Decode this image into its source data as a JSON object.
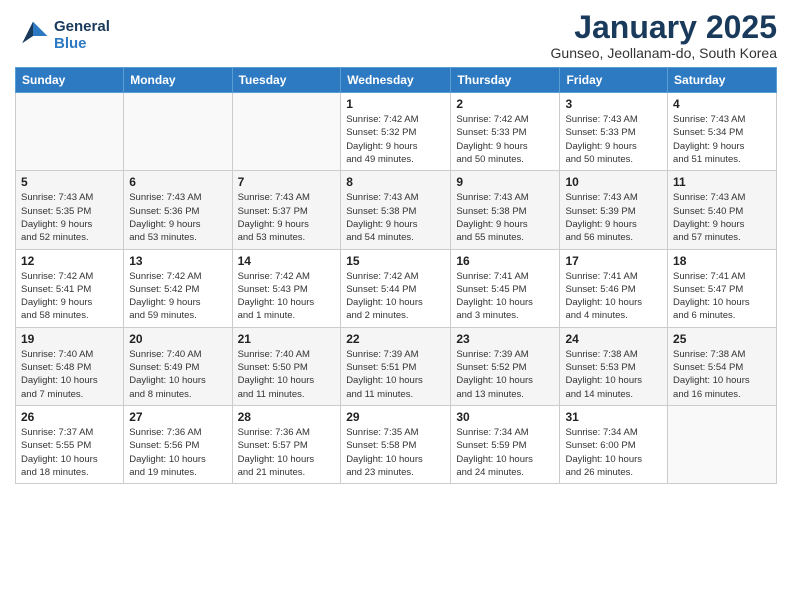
{
  "header": {
    "logo_line1": "General",
    "logo_line2": "Blue",
    "title": "January 2025",
    "subtitle": "Gunseo, Jeollanam-do, South Korea"
  },
  "weekdays": [
    "Sunday",
    "Monday",
    "Tuesday",
    "Wednesday",
    "Thursday",
    "Friday",
    "Saturday"
  ],
  "weeks": [
    [
      {
        "day": "",
        "info": ""
      },
      {
        "day": "",
        "info": ""
      },
      {
        "day": "",
        "info": ""
      },
      {
        "day": "1",
        "info": "Sunrise: 7:42 AM\nSunset: 5:32 PM\nDaylight: 9 hours\nand 49 minutes."
      },
      {
        "day": "2",
        "info": "Sunrise: 7:42 AM\nSunset: 5:33 PM\nDaylight: 9 hours\nand 50 minutes."
      },
      {
        "day": "3",
        "info": "Sunrise: 7:43 AM\nSunset: 5:33 PM\nDaylight: 9 hours\nand 50 minutes."
      },
      {
        "day": "4",
        "info": "Sunrise: 7:43 AM\nSunset: 5:34 PM\nDaylight: 9 hours\nand 51 minutes."
      }
    ],
    [
      {
        "day": "5",
        "info": "Sunrise: 7:43 AM\nSunset: 5:35 PM\nDaylight: 9 hours\nand 52 minutes."
      },
      {
        "day": "6",
        "info": "Sunrise: 7:43 AM\nSunset: 5:36 PM\nDaylight: 9 hours\nand 53 minutes."
      },
      {
        "day": "7",
        "info": "Sunrise: 7:43 AM\nSunset: 5:37 PM\nDaylight: 9 hours\nand 53 minutes."
      },
      {
        "day": "8",
        "info": "Sunrise: 7:43 AM\nSunset: 5:38 PM\nDaylight: 9 hours\nand 54 minutes."
      },
      {
        "day": "9",
        "info": "Sunrise: 7:43 AM\nSunset: 5:38 PM\nDaylight: 9 hours\nand 55 minutes."
      },
      {
        "day": "10",
        "info": "Sunrise: 7:43 AM\nSunset: 5:39 PM\nDaylight: 9 hours\nand 56 minutes."
      },
      {
        "day": "11",
        "info": "Sunrise: 7:43 AM\nSunset: 5:40 PM\nDaylight: 9 hours\nand 57 minutes."
      }
    ],
    [
      {
        "day": "12",
        "info": "Sunrise: 7:42 AM\nSunset: 5:41 PM\nDaylight: 9 hours\nand 58 minutes."
      },
      {
        "day": "13",
        "info": "Sunrise: 7:42 AM\nSunset: 5:42 PM\nDaylight: 9 hours\nand 59 minutes."
      },
      {
        "day": "14",
        "info": "Sunrise: 7:42 AM\nSunset: 5:43 PM\nDaylight: 10 hours\nand 1 minute."
      },
      {
        "day": "15",
        "info": "Sunrise: 7:42 AM\nSunset: 5:44 PM\nDaylight: 10 hours\nand 2 minutes."
      },
      {
        "day": "16",
        "info": "Sunrise: 7:41 AM\nSunset: 5:45 PM\nDaylight: 10 hours\nand 3 minutes."
      },
      {
        "day": "17",
        "info": "Sunrise: 7:41 AM\nSunset: 5:46 PM\nDaylight: 10 hours\nand 4 minutes."
      },
      {
        "day": "18",
        "info": "Sunrise: 7:41 AM\nSunset: 5:47 PM\nDaylight: 10 hours\nand 6 minutes."
      }
    ],
    [
      {
        "day": "19",
        "info": "Sunrise: 7:40 AM\nSunset: 5:48 PM\nDaylight: 10 hours\nand 7 minutes."
      },
      {
        "day": "20",
        "info": "Sunrise: 7:40 AM\nSunset: 5:49 PM\nDaylight: 10 hours\nand 8 minutes."
      },
      {
        "day": "21",
        "info": "Sunrise: 7:40 AM\nSunset: 5:50 PM\nDaylight: 10 hours\nand 11 minutes."
      },
      {
        "day": "22",
        "info": "Sunrise: 7:39 AM\nSunset: 5:51 PM\nDaylight: 10 hours\nand 11 minutes."
      },
      {
        "day": "23",
        "info": "Sunrise: 7:39 AM\nSunset: 5:52 PM\nDaylight: 10 hours\nand 13 minutes."
      },
      {
        "day": "24",
        "info": "Sunrise: 7:38 AM\nSunset: 5:53 PM\nDaylight: 10 hours\nand 14 minutes."
      },
      {
        "day": "25",
        "info": "Sunrise: 7:38 AM\nSunset: 5:54 PM\nDaylight: 10 hours\nand 16 minutes."
      }
    ],
    [
      {
        "day": "26",
        "info": "Sunrise: 7:37 AM\nSunset: 5:55 PM\nDaylight: 10 hours\nand 18 minutes."
      },
      {
        "day": "27",
        "info": "Sunrise: 7:36 AM\nSunset: 5:56 PM\nDaylight: 10 hours\nand 19 minutes."
      },
      {
        "day": "28",
        "info": "Sunrise: 7:36 AM\nSunset: 5:57 PM\nDaylight: 10 hours\nand 21 minutes."
      },
      {
        "day": "29",
        "info": "Sunrise: 7:35 AM\nSunset: 5:58 PM\nDaylight: 10 hours\nand 23 minutes."
      },
      {
        "day": "30",
        "info": "Sunrise: 7:34 AM\nSunset: 5:59 PM\nDaylight: 10 hours\nand 24 minutes."
      },
      {
        "day": "31",
        "info": "Sunrise: 7:34 AM\nSunset: 6:00 PM\nDaylight: 10 hours\nand 26 minutes."
      },
      {
        "day": "",
        "info": ""
      }
    ]
  ]
}
